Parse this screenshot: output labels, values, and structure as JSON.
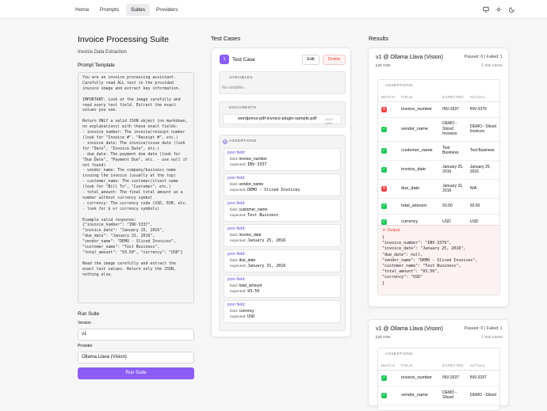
{
  "nav": {
    "home": "Home",
    "prompts": "Prompts",
    "suites": "Suites",
    "providers": "Providers"
  },
  "suite": {
    "title": "Invoice Processing Suite",
    "subtitle": "Invoice Data Extraction"
  },
  "prompt_template": {
    "label": "Prompt Template",
    "text": "You are an invoice processing assistant.\nCarefully read ALL text in the provided\ninvoice image and extract key information.\n\nIMPORTANT: Look at the image carefully and\nread every text field. Extract the exact\nvalues you see.\n\nReturn ONLY a valid JSON object (no markdown,\nno explanations) with these exact fields:\n- invoice_number: The invoice/receipt number\n(look for \"Invoice #\", \"Receipt #\", etc.)\n- invoice_date: The invoice/issue date (look\nfor \"Date\", \"Invoice Date\", etc.)\n- due_date: The payment due date (look for\n\"Due Date\", \"Payment Due\", etc. - use null if\nnot found)\n- vendor_name: The company/business name\nissuing the invoice (usually at the top)\n- customer_name: The customer/client name\n(look for \"Bill To\", \"Customer\", etc.)\n- total_amount: The final total amount as a\nnumber without currency symbol\n- currency: The currency code (USD, EUR, etc.\n- look for $ or currency symbols)\n\nExample valid response:\n{\"invoice_number\": \"INV-3337\",\n\"invoice_date\": \"January 25, 2016\",\n\"due_date\": \"January 31, 2016\",\n\"vendor_name\": \"DEMO - Sliced Invoices\",\n\"customer_name\": \"Test Business\",\n\"total_amount\": \"93.50\", \"currency\": \"USD\"}\n\nRead the image carefully and extract the\nexact text values. Return only the JSON,\nnothing else."
  },
  "run_suite": {
    "label": "Run Suite",
    "version_label": "Version",
    "version_value": "v1",
    "provider_label": "Provider",
    "provider_value": "Ollama Llava (Vision)",
    "button": "Run Suite"
  },
  "test_cases": {
    "heading": "Test Cases",
    "badge": "1",
    "name": "Test Case",
    "edit": "Edit",
    "delete": "Delete",
    "variables_title": "VARIABLES",
    "variables_empty": "No variables",
    "documents_title": "DOCUMENTS",
    "document_name": "wordpress-pdf-invoice-plugin-sample.pdf",
    "document_size": "43627 bytes",
    "assertions_title": "ASSERTIONS",
    "field_prefix": "field:",
    "expected_prefix": "expected:",
    "assertions": [
      {
        "type": "json field:",
        "field": "invoice_number",
        "expected": "INV-3337"
      },
      {
        "type": "json field:",
        "field": "vendor_name",
        "expected": "DEMO - Sliced Invoices"
      },
      {
        "type": "json field:",
        "field": "customer_name",
        "expected": "Test Business"
      },
      {
        "type": "json field:",
        "field": "invoice_date",
        "expected": "January 25, 2016"
      },
      {
        "type": "json field:",
        "field": "due_date",
        "expected": "January 31, 2016"
      },
      {
        "type": "json field:",
        "field": "total_amount",
        "expected": "93.50"
      },
      {
        "type": "json field:",
        "field": "currency",
        "expected": "USD"
      }
    ]
  },
  "results": {
    "heading": "Results",
    "cards": [
      {
        "title": "v1 @ Ollama Llava (Vision)",
        "time": "just now",
        "passfail": "Passed: 0 | Failed: 1",
        "count": "1 test cases",
        "assertions_title": "ASSERTIONS",
        "columns": [
          "MATCH",
          "FIELD",
          "EXPECTED",
          "ACTUAL"
        ],
        "rows": [
          {
            "match": "fail",
            "field": "invoice_number",
            "expected": "INV-3337",
            "actual": "INV-3379"
          },
          {
            "match": "pass",
            "field": "vendor_name",
            "expected": "DEMO - Sliced Invoices",
            "actual": "DEMO - Sliced Invoices"
          },
          {
            "match": "pass",
            "field": "customer_name",
            "expected": "Test Business",
            "actual": "Test Business"
          },
          {
            "match": "pass",
            "field": "invoice_date",
            "expected": "January 25, 2016",
            "actual": "January 25, 2016"
          },
          {
            "match": "fail",
            "field": "due_date",
            "expected": "January 31, 2016",
            "actual": "N/A"
          },
          {
            "match": "pass",
            "field": "total_amount",
            "expected": "93.50",
            "actual": "93.50"
          },
          {
            "match": "pass",
            "field": "currency",
            "expected": "USD",
            "actual": "USD"
          }
        ],
        "output_label": "Output",
        "output_text": "{\n\"invoice_number\": \"INV-3379\",\n\"invoice_date\": \"January 25, 2016\",\n\"due_date\": null,\n\"vendor_name\": \"DEMO - Sliced Invoices\",\n\"customer_name\": \"Test Business\",\n\"total_amount\": \"93.50\",\n\"currency\": \"USD\"\n}"
      },
      {
        "title": "v1 @ Ollama Llava (Vision)",
        "time": "just now",
        "passfail": "Passed: 0 | Failed: 1",
        "count": "1 test cases",
        "assertions_title": "ASSERTIONS",
        "columns": [
          "MATCH",
          "FIELD",
          "EXPECTED",
          "ACTUAL"
        ],
        "rows": [
          {
            "match": "pass",
            "field": "invoice_number",
            "expected": "INV-3337",
            "actual": "INV-3337"
          },
          {
            "match": "pass",
            "field": "vendor_name",
            "expected": "DEMO - Sliced",
            "actual": "DEMO - Sliced"
          }
        ]
      }
    ]
  },
  "colors": {
    "accent": "#8b5cf6",
    "pass": "#22c55e",
    "fail": "#ef4444",
    "link": "#5b4dd6"
  }
}
